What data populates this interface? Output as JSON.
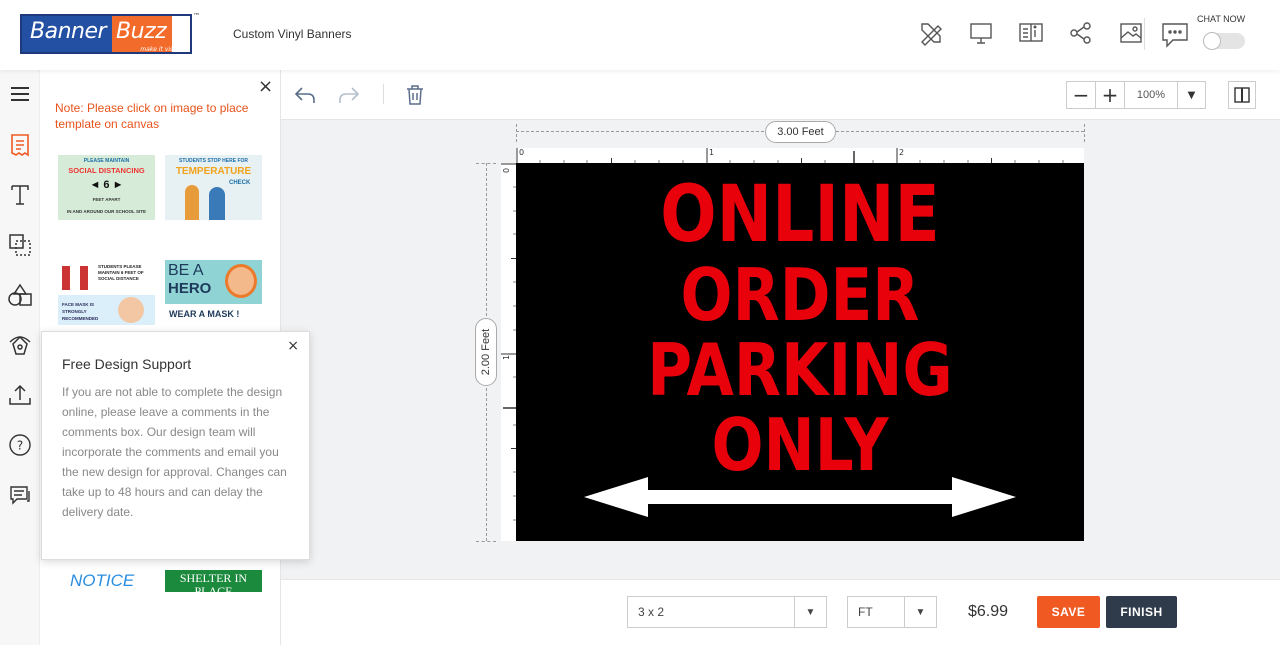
{
  "header": {
    "logo_part1": "Banner",
    "logo_part2": "Buzz",
    "logo_tagline": "make it visible",
    "logo_tm": "™",
    "product_title": "Custom Vinyl Banners",
    "chat_label": "CHAT NOW",
    "icons": [
      "design-tools-icon",
      "preview-desktop-icon",
      "book-info-icon",
      "share-icon",
      "image-icon",
      "chat-icon"
    ]
  },
  "leftnav": {
    "icons": [
      "menu-icon",
      "templates-icon",
      "text-icon",
      "layers-icon",
      "shapes-icon",
      "clipart-icon",
      "upload-icon",
      "help-icon",
      "comments-icon"
    ]
  },
  "panel": {
    "close": "×",
    "note": "Note: Please click on image to place template on canvas",
    "templates": [
      {
        "line1": "PLEASE MAINTAIN",
        "line2": "SOCIAL DISTANCING",
        "line3": "◄ 6 ►",
        "line4": "FEET APART",
        "line5": "IN AND AROUND OUR SCHOOL SITE"
      },
      {
        "line1": "STUDENTS STOP HERE FOR",
        "line2": "TEMPERATURE",
        "line3": "CHECK"
      },
      {
        "line1": "STUDENTS PLEASE MAINTAIN 6 FEET OF SOCIAL DISTANCE",
        "line2": "FACE MASK IS STRONGLY RECOMMENDED"
      },
      {
        "line1": "BE A",
        "line2": "HERO",
        "line3": "WEAR A MASK !"
      },
      {
        "line1": "NOTICE"
      },
      {
        "line1": "SHELTER IN PLACE"
      }
    ]
  },
  "popup": {
    "close": "×",
    "title": "Free Design Support",
    "body": "If you are not able to complete the design online, please leave a comments in the comments box. Our design team will incorporate the comments and email you the new design for approval. Changes can take up to 48 hours and can delay the delivery date."
  },
  "toolbar": {
    "zoom_minus": "−",
    "zoom_plus": "+",
    "zoom_value": "100%",
    "zoom_caret": "▼"
  },
  "canvas": {
    "width_label": "3.00 Feet",
    "height_label": "2.00 Feet",
    "ruler_top": [
      "0",
      "1",
      "2"
    ],
    "ruler_left": [
      "0",
      "1"
    ],
    "banner_lines": [
      "ONLINE",
      "ORDER",
      "PARKING",
      "ONLY"
    ],
    "banner_bg": "#000000",
    "banner_text_color": "#e8000b",
    "arrow_color": "#ffffff"
  },
  "bottom": {
    "size_value": "3 x 2",
    "unit_value": "FT",
    "caret": "▼",
    "price": "$6.99",
    "save_label": "SAVE",
    "finish_label": "FINISH"
  },
  "colors": {
    "accent": "#f05a22",
    "dark": "#2f3a4a",
    "note": "#e8541c"
  }
}
